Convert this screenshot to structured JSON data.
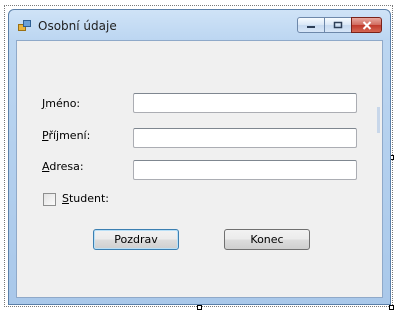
{
  "window": {
    "title": "Osobní údaje",
    "caption_buttons": [
      "minimize",
      "maximize",
      "close"
    ]
  },
  "form": {
    "labels": {
      "jmeno": {
        "accel": "J",
        "rest": "méno:"
      },
      "prijmeni": {
        "accel": "P",
        "rest": "říjmení:"
      },
      "adresa": {
        "accel": "A",
        "rest": "dresa:"
      },
      "student": {
        "accel": "S",
        "rest": "tudent:"
      }
    },
    "fields": {
      "jmeno": {
        "value": ""
      },
      "prijmeni": {
        "value": ""
      },
      "adresa": {
        "value": ""
      }
    },
    "student_checked": false,
    "buttons": {
      "pozdrav": "Pozdrav",
      "konec": "Konec"
    }
  },
  "colors": {
    "client_bg": "#f0f0f0",
    "frame": "#bcd6f1",
    "close_button": "#c0392b",
    "default_button_border": "#3c7fb1"
  }
}
